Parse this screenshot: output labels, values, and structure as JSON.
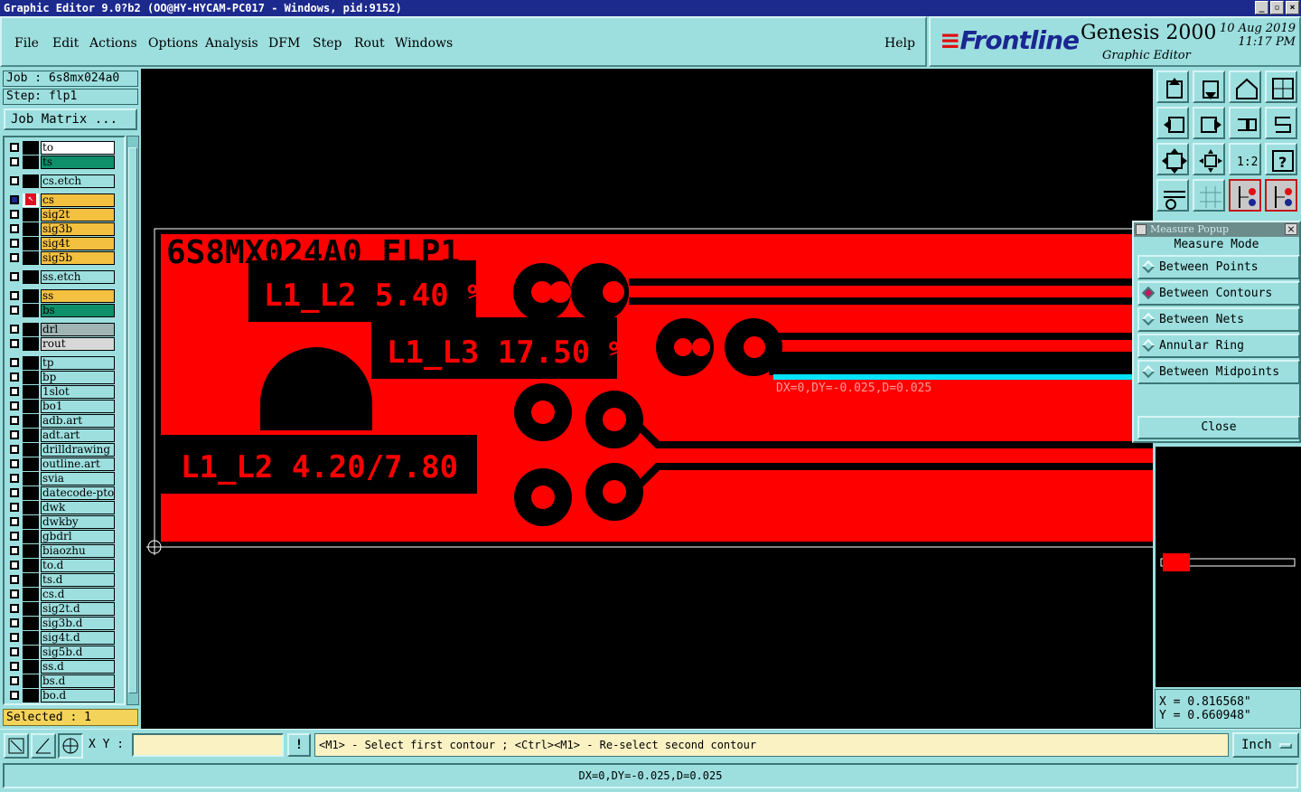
{
  "window": {
    "title": "Graphic Editor 9.0?b2 (OO@HY-HYCAM-PC017 - Windows, pid:9152)",
    "buttons": [
      "_",
      "▫",
      "×"
    ]
  },
  "menu": [
    "File",
    "Edit",
    "Actions",
    "Options",
    "Analysis",
    "DFM",
    "Step",
    "Rout",
    "Windows"
  ],
  "help": "Help",
  "brand": {
    "logo": "Frontline",
    "product": "Genesis 2000",
    "subtitle": "Graphic Editor",
    "date": "10 Aug 2019",
    "time": "11:17 PM"
  },
  "job": {
    "job_line": "Job : 6s8mx024a0",
    "step_line": "Step: flp1",
    "matrix_button": "Job Matrix ..."
  },
  "layers": [
    {
      "name": "to",
      "color": "#ffffff"
    },
    {
      "name": "ts",
      "color": "#0f8f6a"
    },
    {
      "name": "cs.etch",
      "color": "#9ddfdf"
    },
    {
      "name": "cs",
      "color": "#f4c040"
    },
    {
      "name": "sig2t",
      "color": "#f4c040"
    },
    {
      "name": "sig3b",
      "color": "#f4c040"
    },
    {
      "name": "sig4t",
      "color": "#f4c040"
    },
    {
      "name": "sig5b",
      "color": "#f4c040"
    },
    {
      "name": "ss.etch",
      "color": "#9ddfdf"
    },
    {
      "name": "ss",
      "color": "#f4c040"
    },
    {
      "name": "bs",
      "color": "#0f8f6a"
    },
    {
      "name": "drl",
      "color": "#a0b4b4"
    },
    {
      "name": "rout",
      "color": "#d8d8d8"
    },
    {
      "name": "tp",
      "color": "#9ddfdf"
    },
    {
      "name": "bp",
      "color": "#9ddfdf"
    },
    {
      "name": "1slot",
      "color": "#9ddfdf"
    },
    {
      "name": "bo1",
      "color": "#9ddfdf"
    },
    {
      "name": "adb.art",
      "color": "#9ddfdf"
    },
    {
      "name": "adt.art",
      "color": "#9ddfdf"
    },
    {
      "name": "drilldrawing",
      "color": "#9ddfdf"
    },
    {
      "name": "outline.art",
      "color": "#9ddfdf"
    },
    {
      "name": "svia",
      "color": "#9ddfdf"
    },
    {
      "name": "datecode-pto",
      "color": "#9ddfdf"
    },
    {
      "name": "dwk",
      "color": "#9ddfdf"
    },
    {
      "name": "dwkby",
      "color": "#9ddfdf"
    },
    {
      "name": "gbdrl",
      "color": "#9ddfdf"
    },
    {
      "name": "biaozhu",
      "color": "#9ddfdf"
    },
    {
      "name": "to.d",
      "color": "#9ddfdf"
    },
    {
      "name": "ts.d",
      "color": "#9ddfdf"
    },
    {
      "name": "cs.d",
      "color": "#9ddfdf"
    },
    {
      "name": "sig2t.d",
      "color": "#9ddfdf"
    },
    {
      "name": "sig3b.d",
      "color": "#9ddfdf"
    },
    {
      "name": "sig4t.d",
      "color": "#9ddfdf"
    },
    {
      "name": "sig5b.d",
      "color": "#9ddfdf"
    },
    {
      "name": "ss.d",
      "color": "#9ddfdf"
    },
    {
      "name": "bs.d",
      "color": "#9ddfdf"
    },
    {
      "name": "bo.d",
      "color": "#9ddfdf"
    }
  ],
  "selected_text": "Selected : 1",
  "canvas": {
    "board_title": "6S8MX024A0 FLP1",
    "label_1": "L1_L2 5.40 %",
    "label_2": "L1_L3 17.50 %",
    "label_3": "L1_L2 4.20/7.80 %",
    "measure_readout": "DX=0,DY=-0.025,D=0.025",
    "copper_color": "#ff0000",
    "measure_color": "#00e5ff"
  },
  "measure_popup": {
    "title": "Measure Popup",
    "mode_label": "Measure Mode",
    "options": [
      "Between Points",
      "Between Contours",
      "Between Nets",
      "Annular Ring",
      "Between Midpoints"
    ],
    "selected": "Between Contours",
    "close_label": "Close"
  },
  "coords": {
    "x": "X = 0.816568\"",
    "y": "Y = 0.660948\""
  },
  "bottom": {
    "xy_label": "X Y :",
    "xy_value": "",
    "excl_label": "!",
    "prompt": "<M1> - Select first contour ; <Ctrl><M1> - Re-select second contour",
    "unit": "Inch"
  },
  "status": "DX=0,DY=-0.025,D=0.025",
  "toolbar_icons": [
    "zoom-prev-icon",
    "zoom-next-icon",
    "home-icon",
    "window-icon",
    "pan-left-icon",
    "pan-right-icon",
    "pan-back-icon",
    "s-curve-icon",
    "fit-screen-icon",
    "zoom-center-icon",
    "scale-1-2-icon",
    "help-icon",
    "tools-icon",
    "grid-icon",
    "snap-icon",
    "snap-alt-icon"
  ]
}
